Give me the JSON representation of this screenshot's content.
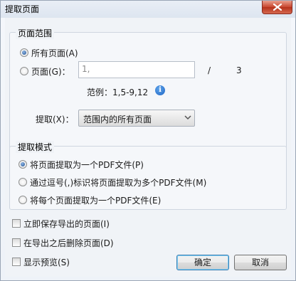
{
  "window": {
    "title": "提取页面",
    "close_icon": "close-icon"
  },
  "page_range": {
    "group_title": "页面范围",
    "all_pages_label": "所有页面(A)",
    "pages_label": "页面(G)：",
    "pages_input_placeholder": "1,",
    "separator": "/",
    "total_pages": "3",
    "example_label": "范例：1,5-9,12",
    "info_icon": "info-icon",
    "extract_label": "提取(X)：",
    "extract_selected": "范围内的所有页面"
  },
  "extract_mode": {
    "group_title": "提取模式",
    "options": [
      {
        "label": "将页面提取为一个PDF文件(P)",
        "checked": true
      },
      {
        "label": "通过逗号(,)标识将页面提取为多个PDF文件(M)",
        "checked": false
      },
      {
        "label": "将每个页面提取为一个PDF文件(E)",
        "checked": false
      }
    ]
  },
  "options": {
    "save_immediately": "立即保存导出的页面(I)",
    "delete_after_export": "在导出之后删除页面(D)",
    "show_preview": "显示预览(S)"
  },
  "buttons": {
    "ok": "确定",
    "cancel": "取消"
  }
}
